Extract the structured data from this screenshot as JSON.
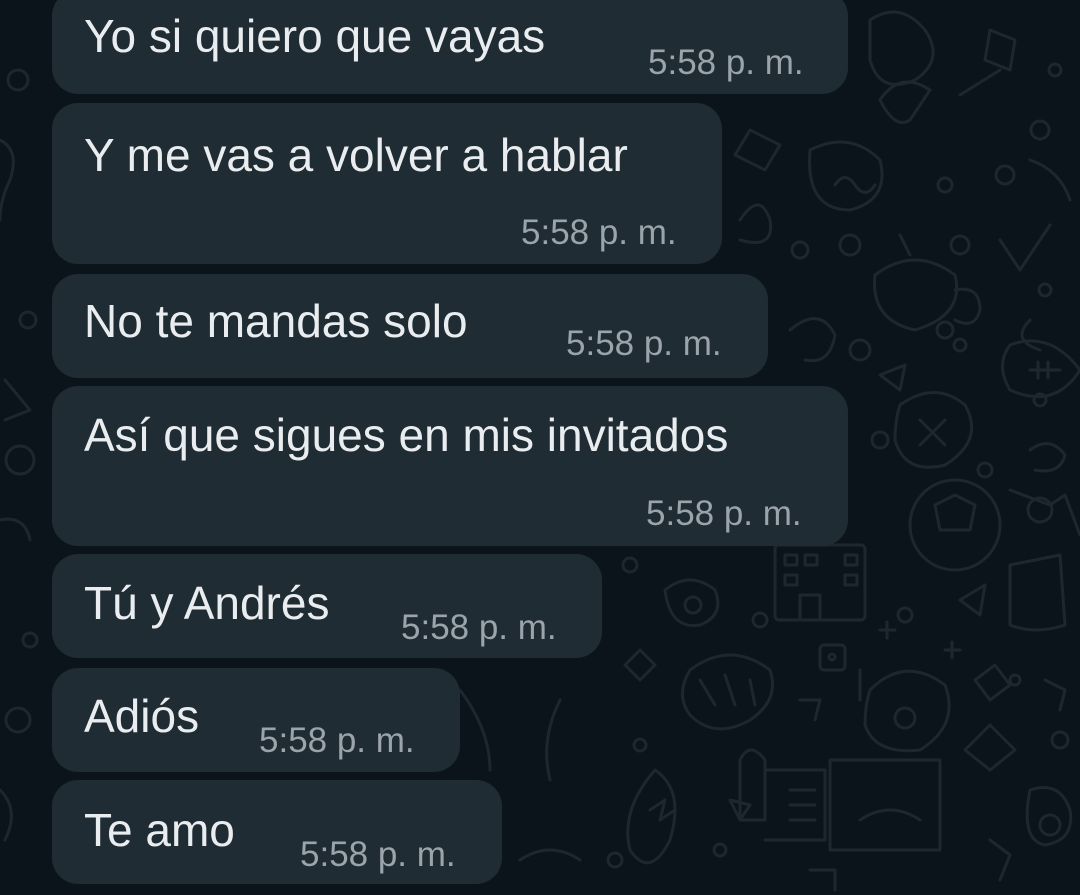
{
  "theme": {
    "background": "#0b141a",
    "bubble_color": "#202c33",
    "text_color": "#e9edef",
    "time_color": "#9ba4aa"
  },
  "messages": [
    {
      "text": "Yo si quiero que vayas",
      "time": "5:58 p. m."
    },
    {
      "text": "Y me vas a volver a hablar",
      "time": "5:58 p. m."
    },
    {
      "text": "No te mandas solo",
      "time": "5:58 p. m."
    },
    {
      "text": "Así que sigues en mis invitados",
      "time": "5:58 p. m."
    },
    {
      "text": "Tú y Andrés",
      "time": "5:58 p. m."
    },
    {
      "text": "Adiós",
      "time": "5:58 p. m."
    },
    {
      "text": "Te amo",
      "time": "5:58 p. m."
    }
  ]
}
